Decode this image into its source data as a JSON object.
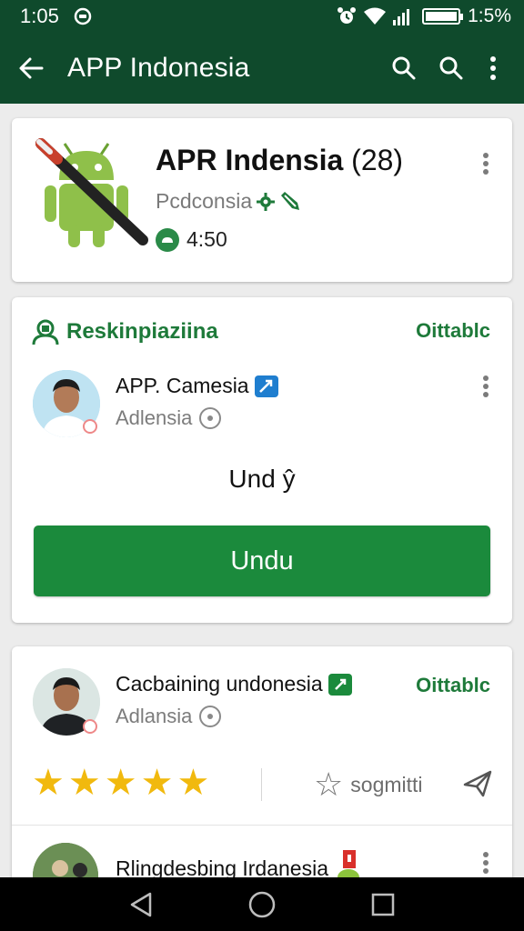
{
  "status_bar": {
    "time": "1:05",
    "battery_text": "1:5%"
  },
  "app_bar": {
    "title": "APP Indonesia"
  },
  "app_card": {
    "name": "APR Indensia",
    "count": "(28)",
    "publisher": "Pcdconsia",
    "time": "4:50"
  },
  "section_card": {
    "heading": "Reskinpiaziina",
    "status": "Oittablc",
    "person_name": "APP. Camesia",
    "person_sub": "Adlensia",
    "status_text": "Und ŷ",
    "button_label": "Undu"
  },
  "review_card": {
    "person_name": "Cacbaining undonesia",
    "status": "Oittablc",
    "person_sub": "Adlansia",
    "rating": 5,
    "suggest_label": "sogmitti",
    "next_name": "Rlingdesbing Irdanesia"
  },
  "colors": {
    "brand": "#0f4a2c",
    "accent": "#1b8a3c",
    "star": "#f1b90e"
  }
}
